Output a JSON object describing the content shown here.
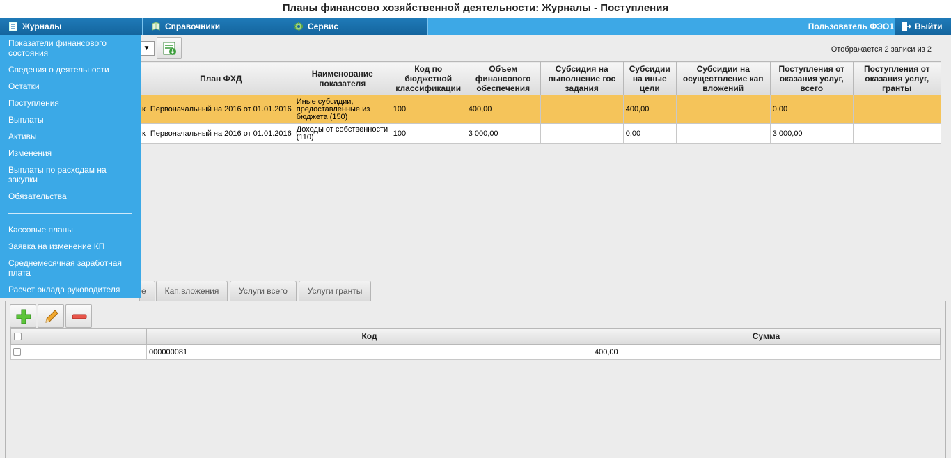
{
  "window": {
    "title": "Планы финансово хозяйственной деятельности: Журналы - Поступления"
  },
  "menubar": {
    "journals_label": "Журналы",
    "references_label": "Справочники",
    "service_label": "Сервис",
    "user_label": "Пользователь ФЭО1",
    "logout_label": "Выйти"
  },
  "nav_menu": {
    "items": [
      "Показатели финансового состояния",
      "Сведения о деятельности",
      "Остатки",
      "Поступления",
      "Выплаты",
      "Активы",
      "Изменения",
      "Выплаты по расходам на закупки",
      "Обязательства",
      "Кассовые планы",
      "Заявка на изменение КП",
      "Среднемесячная заработная плата",
      "Расчет оклада руководителя"
    ]
  },
  "toolbar": {
    "select_arrow": "▼",
    "records_count": "Отображается 2 записи из 2"
  },
  "grid": {
    "columns": [
      "План ФХД",
      "Наименование показателя",
      "Код по бюджетной классификации",
      "Объем финансового обеспечения",
      "Субсидия на выполнение гос задания",
      "Субсидии на иные цели",
      "Субсидии на осуществление кап вложений",
      "Поступления от оказания услуг, всего",
      "Поступления от оказания услуг, гранты"
    ],
    "rows": [
      {
        "stub": "к",
        "plan": "Первоначальный на 2016 от 01.01.2016",
        "name": "Иные субсидии, предоставленные из бюджета (150)",
        "code": "100",
        "volume": "400,00",
        "gov_task": "",
        "other": "400,00",
        "capital": "",
        "services_total": "0,00",
        "grants": ""
      },
      {
        "stub": "к",
        "plan": "Первоначальный на 2016 от 01.01.2016",
        "name": "Доходы от собственности (110)",
        "code": "100",
        "volume": "3 000,00",
        "gov_task": "",
        "other": "0,00",
        "capital": "",
        "services_total": "3 000,00",
        "grants": ""
      }
    ]
  },
  "tabs": {
    "stub": "е",
    "items": [
      "Кап.вложения",
      "Услуги всего",
      "Услуги гранты"
    ]
  },
  "sub_grid": {
    "columns": [
      "Код",
      "Сумма"
    ],
    "rows": [
      {
        "code": "000000081",
        "sum": "400,00"
      }
    ]
  }
}
